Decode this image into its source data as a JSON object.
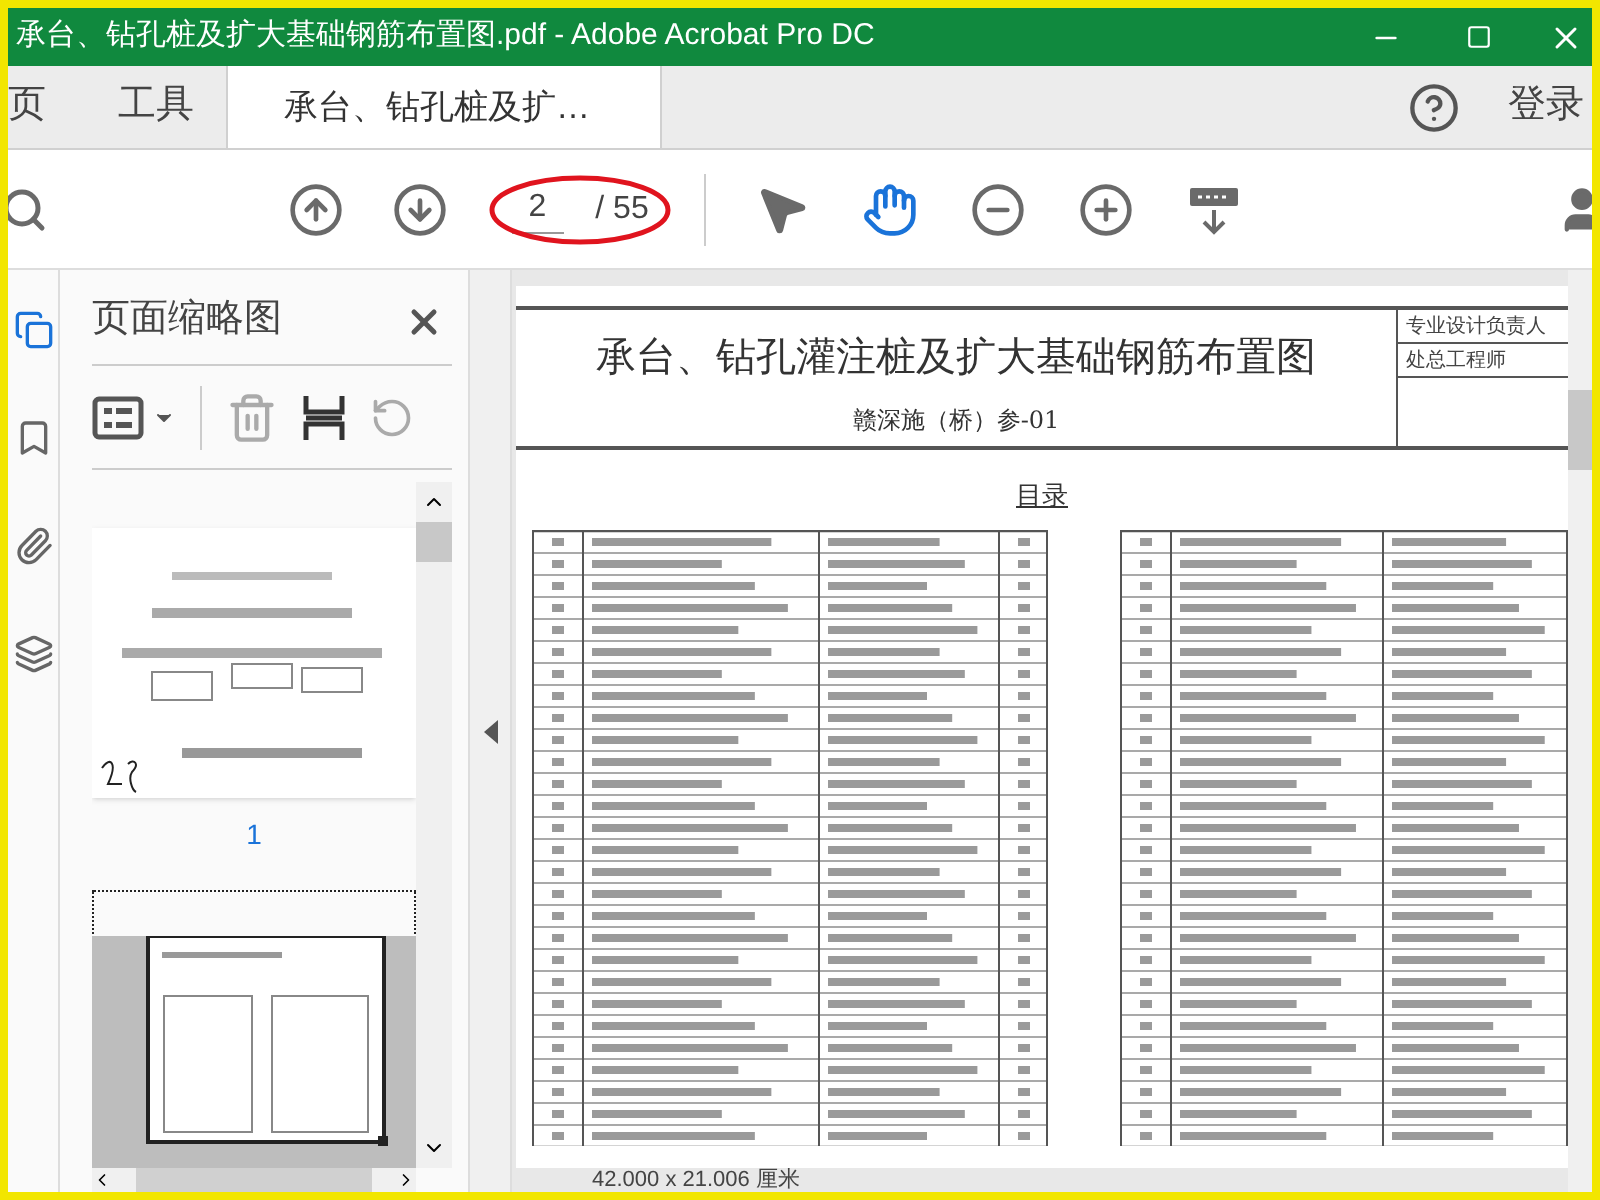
{
  "window": {
    "title": "承台、钻孔桩及扩大基础钢筋布置图.pdf - Adobe Acrobat Pro DC"
  },
  "tabs": [
    {
      "label": "页",
      "kind": "nav",
      "selected": false
    },
    {
      "label": "工具",
      "kind": "nav",
      "selected": false
    },
    {
      "label": "承台、钻孔桩及扩…",
      "kind": "document",
      "selected": true
    }
  ],
  "signin": "登录",
  "toolbar": {
    "page_current": "2",
    "page_total": "/ 55",
    "page_circled": true,
    "tools": [
      {
        "kind": "pointer",
        "selected": false
      },
      {
        "kind": "hand",
        "selected": true
      },
      {
        "kind": "zoom-out",
        "selected": false
      },
      {
        "kind": "zoom-in",
        "selected": false
      },
      {
        "kind": "fit",
        "selected": false
      }
    ]
  },
  "side_nav": [
    {
      "kind": "pages",
      "selected": true
    },
    {
      "kind": "bookmarks",
      "selected": false
    },
    {
      "kind": "attachments",
      "selected": false
    },
    {
      "kind": "layers",
      "selected": false
    }
  ],
  "thumbnail_panel": {
    "title": "页面缩略图",
    "thumbnails": [
      {
        "label": "1",
        "selected": false,
        "kind": "cover"
      },
      {
        "selected": true,
        "kind": "table"
      }
    ]
  },
  "document": {
    "title": "承台、钻孔灌注桩及扩大基础钢筋布置图",
    "code": "赣深施（桥）参-01",
    "sign_off": [
      "专业设计负责人",
      "处总工程师"
    ],
    "contents_heading": "目录"
  },
  "status_bar": {
    "page_size": "42.000 x 21.006 厘米"
  }
}
